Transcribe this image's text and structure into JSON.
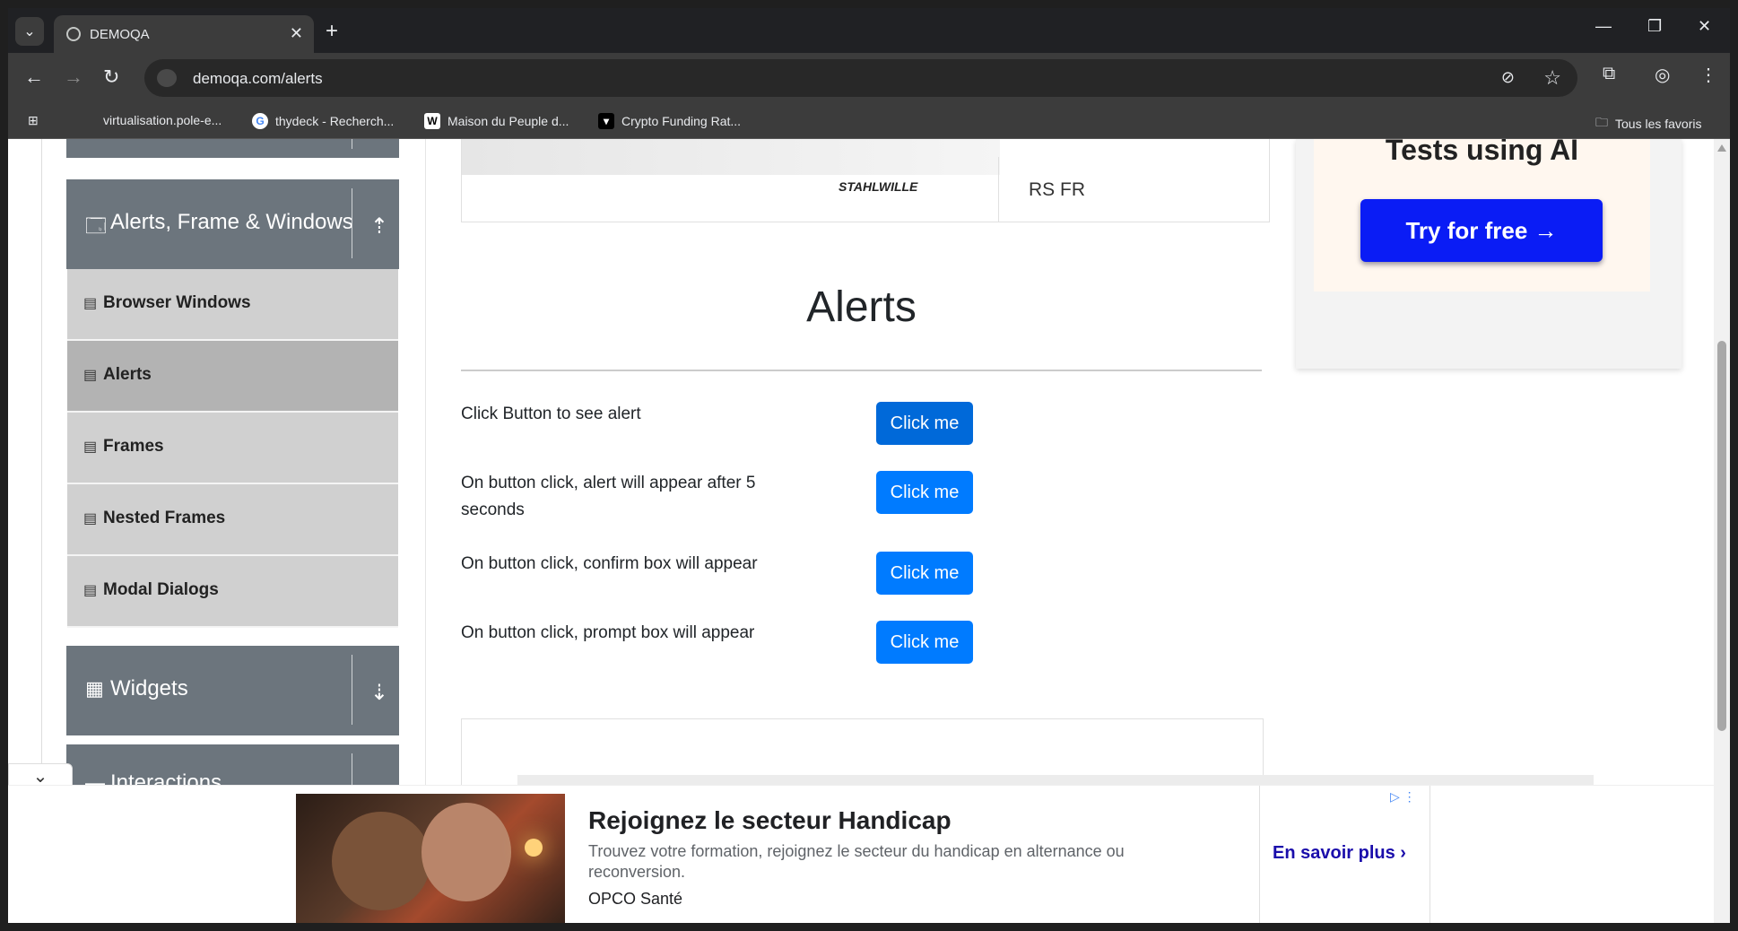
{
  "browser": {
    "tab_title": "DEMOQA",
    "url": "demoqa.com/alerts",
    "bookmarks": [
      {
        "label": "virtualisation.pole-e...",
        "icon": "folder-icon"
      },
      {
        "label": "thydeck - Recherch...",
        "icon": "google-icon"
      },
      {
        "label": "Maison du Peuple d...",
        "icon": "wikipedia-icon"
      },
      {
        "label": "Crypto Funding Rat...",
        "icon": "site-icon"
      }
    ],
    "all_bookmarks": "Tous les favoris",
    "wiki_glyph": "W",
    "google_glyph": "G"
  },
  "sidebar": {
    "alerts_group": "Alerts, Frame & Windows",
    "items": [
      {
        "label": "Browser Windows",
        "active": false
      },
      {
        "label": "Alerts",
        "active": true
      },
      {
        "label": "Frames",
        "active": false
      },
      {
        "label": "Nested Frames",
        "active": false
      },
      {
        "label": "Modal Dialogs",
        "active": false
      }
    ],
    "widgets_group": "Widgets",
    "interactions_group": "Interactions"
  },
  "top_ad": {
    "brand": "STAHLWILLE",
    "text": "RS FR"
  },
  "right_ad": {
    "heading": "Tests using AI",
    "button": "Try for free →"
  },
  "main": {
    "title": "Alerts",
    "rows": [
      {
        "label": "Click Button to see alert",
        "button": "Click me"
      },
      {
        "label": "On button click, alert will appear after 5 seconds",
        "button": "Click me"
      },
      {
        "label": "On button click, confirm box will appear",
        "button": "Click me"
      },
      {
        "label": "On button click, prompt box will appear",
        "button": "Click me"
      }
    ]
  },
  "bottom_ad": {
    "headline": "Rejoignez le secteur Handicap",
    "description": "Trouvez votre formation, rejoignez le secteur du handicap en alternance ou reconversion.",
    "brand": "OPCO Santé",
    "cta": "En savoir plus"
  },
  "colors": {
    "primary_button": "#007bff",
    "sidebar_header": "#6c757d",
    "ad_button": "#0a1cf5"
  }
}
